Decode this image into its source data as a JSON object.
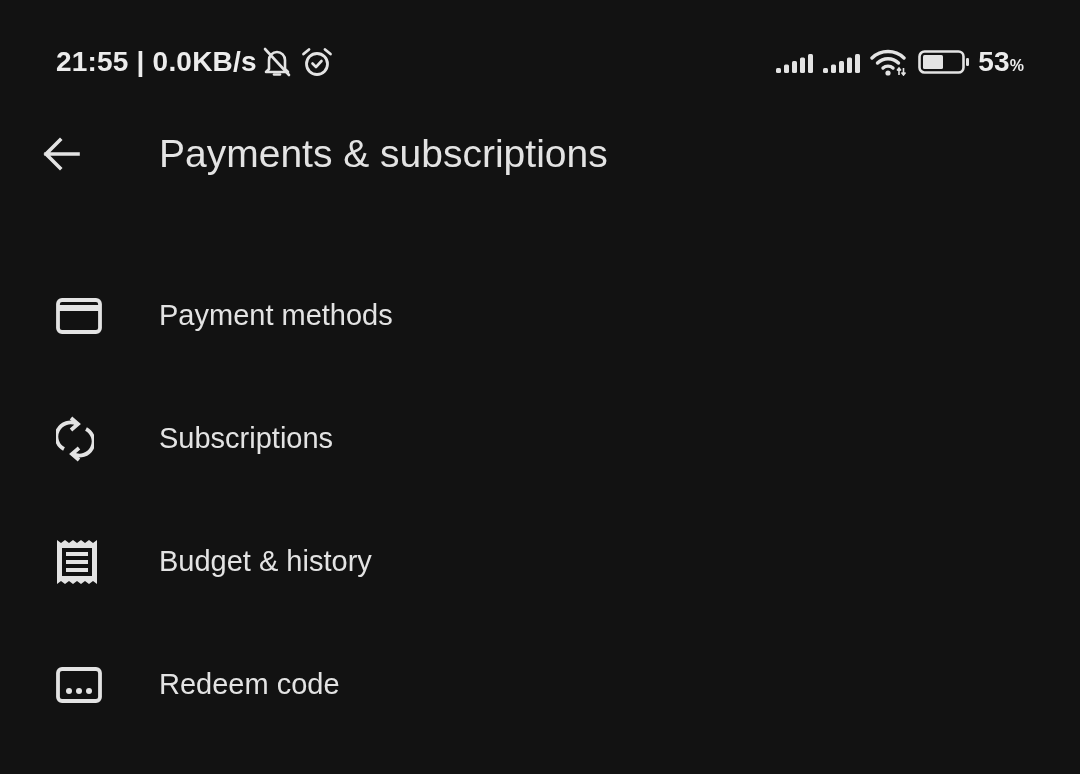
{
  "status_bar": {
    "time_speed": "21:55 | 0.0KB/s",
    "battery_percent": "53",
    "percent_sign": "%"
  },
  "app_bar": {
    "title": "Payments & subscriptions"
  },
  "menu_items": [
    {
      "label": "Payment methods"
    },
    {
      "label": "Subscriptions"
    },
    {
      "label": "Budget & history"
    },
    {
      "label": "Redeem code"
    }
  ]
}
